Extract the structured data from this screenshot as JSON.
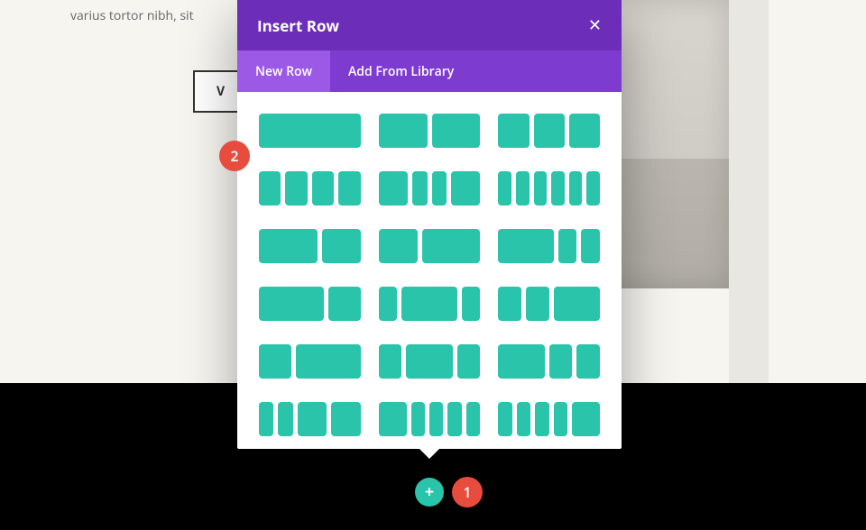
{
  "page": {
    "body_text_fragment": "varius tortor nibh, sit",
    "view_button_fragment": "V"
  },
  "modal": {
    "title": "Insert Row",
    "tabs": {
      "new_row": "New Row",
      "add_from_library": "Add From Library"
    }
  },
  "layouts": [
    [
      1
    ],
    [
      1,
      1
    ],
    [
      1,
      1,
      1
    ],
    [
      1,
      1,
      1,
      1
    ],
    [
      2,
      1,
      1,
      2
    ],
    [
      1,
      1,
      1,
      1,
      1,
      1
    ],
    [
      3,
      2
    ],
    [
      2,
      3
    ],
    [
      3,
      1,
      1
    ],
    [
      2,
      1
    ],
    [
      1,
      3,
      1
    ],
    [
      1,
      1,
      2
    ],
    [
      1,
      2
    ],
    [
      1,
      2,
      1
    ],
    [
      2,
      1,
      1
    ],
    [
      1,
      1,
      2,
      2
    ],
    [
      2,
      1,
      1,
      1,
      1
    ],
    [
      1,
      1,
      1,
      1,
      2
    ]
  ],
  "callouts": {
    "one": "1",
    "two": "2"
  },
  "icons": {
    "add": "+",
    "close": "✕"
  }
}
